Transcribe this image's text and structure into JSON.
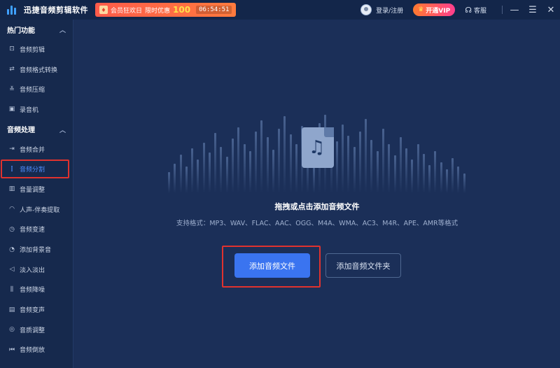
{
  "titlebar": {
    "app_title": "迅捷音频剪辑软件",
    "promo_text": "会员狂欢日",
    "promo_offer": "限时优惠",
    "promo_amount": "100",
    "promo_timer": "06:54:51",
    "login_label": "登录/注册",
    "vip_label": "开通VIP",
    "service_label": "客服"
  },
  "sidebar": {
    "groups": [
      {
        "title": "热门功能",
        "items": [
          {
            "label": "音频剪辑",
            "icon": "scissors-icon"
          },
          {
            "label": "音频格式转换",
            "icon": "convert-icon"
          },
          {
            "label": "音频压缩",
            "icon": "compress-icon"
          },
          {
            "label": "录音机",
            "icon": "recorder-icon"
          }
        ]
      },
      {
        "title": "音频处理",
        "items": [
          {
            "label": "音频合并",
            "icon": "merge-icon"
          },
          {
            "label": "音频分割",
            "icon": "split-icon",
            "active": true
          },
          {
            "label": "音量调整",
            "icon": "volume-icon"
          },
          {
            "label": "人声-伴奏提取",
            "icon": "vocal-icon"
          },
          {
            "label": "音频变速",
            "icon": "speed-icon"
          },
          {
            "label": "添加背景音",
            "icon": "background-music-icon"
          },
          {
            "label": "淡入淡出",
            "icon": "fade-icon"
          },
          {
            "label": "音频降噪",
            "icon": "denoise-icon"
          },
          {
            "label": "音频变声",
            "icon": "voice-change-icon"
          },
          {
            "label": "音质调整",
            "icon": "quality-icon"
          },
          {
            "label": "音频倒放",
            "icon": "reverse-icon"
          }
        ]
      }
    ]
  },
  "main": {
    "drop_title": "拖拽或点击添加音频文件",
    "formats_text": "支持格式：MP3、WAV、FLAC、AAC、OGG、M4A、WMA、AC3、M4R、APE、AMR等格式",
    "add_file_button": "添加音频文件",
    "add_folder_button": "添加音频文件夹"
  },
  "colors": {
    "accent": "#3a74f0",
    "highlight": "#e0322e",
    "background": "#1b2f58",
    "sidebar": "#16294d"
  }
}
